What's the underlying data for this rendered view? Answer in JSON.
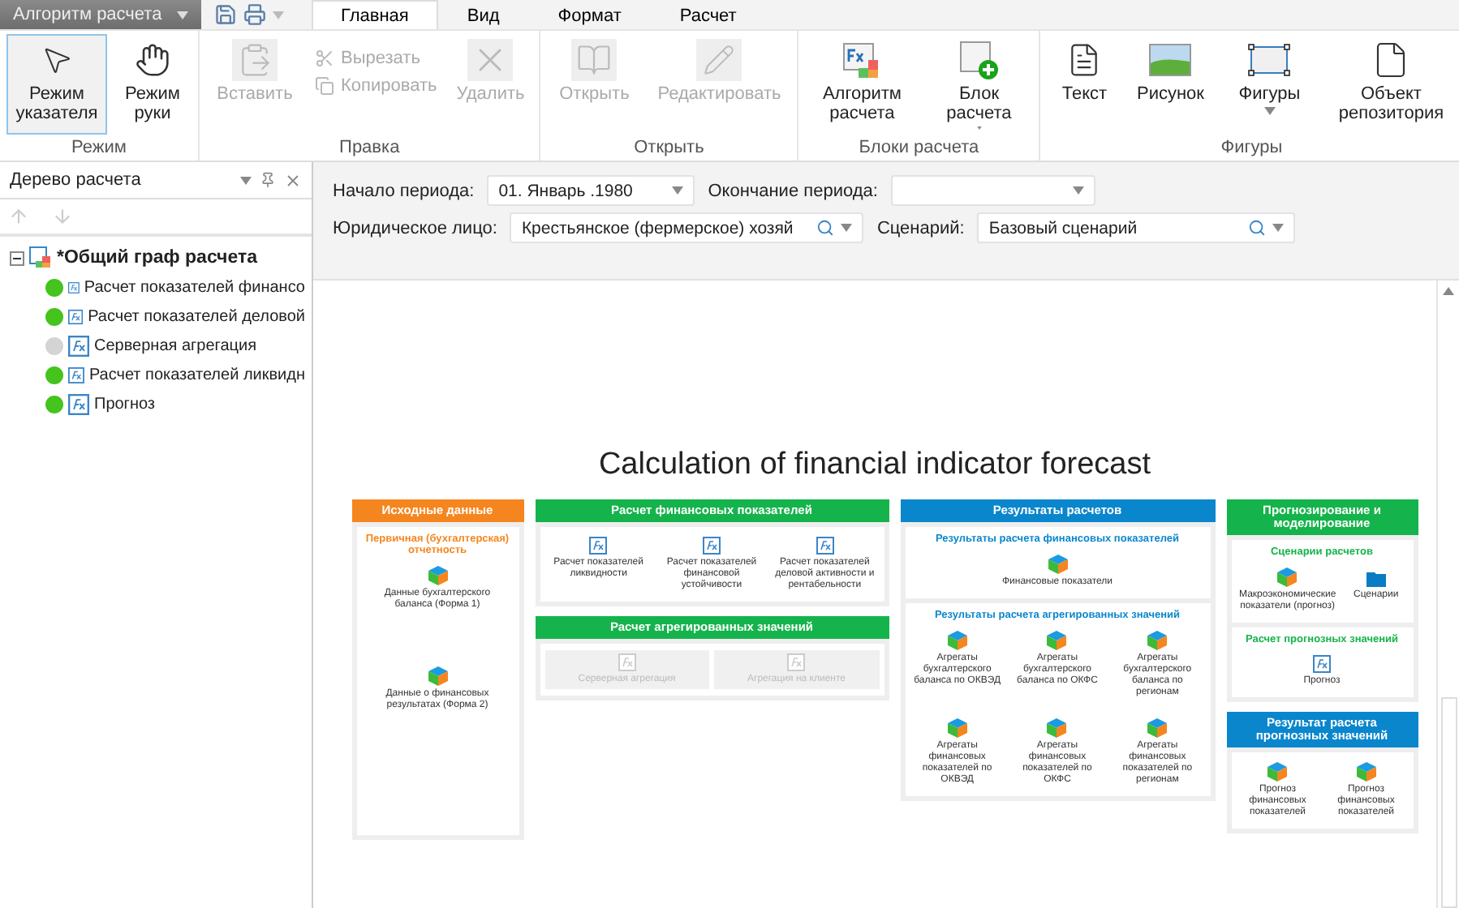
{
  "app_menu": {
    "label": "Алгоритм расчета"
  },
  "tabs": [
    {
      "label": "Главная",
      "selected": true
    },
    {
      "label": "Вид",
      "selected": false
    },
    {
      "label": "Формат",
      "selected": false
    },
    {
      "label": "Расчет",
      "selected": false
    }
  ],
  "ribbon": [
    {
      "label": "Режим",
      "buttons": [
        {
          "label": "Режим указателя",
          "kind": "large",
          "selected": true,
          "disabled": false
        },
        {
          "label": "Режим руки",
          "kind": "large",
          "selected": false,
          "disabled": false
        }
      ]
    },
    {
      "label": "Правка",
      "buttons": [
        {
          "label": "Вставить",
          "kind": "large",
          "selected": false,
          "disabled": true
        },
        {
          "label": "Вырезать",
          "kind": "small",
          "selected": false,
          "disabled": true
        },
        {
          "label": "Копировать",
          "kind": "small",
          "selected": false,
          "disabled": true
        },
        {
          "label": "Удалить",
          "kind": "large",
          "selected": false,
          "disabled": true
        }
      ]
    },
    {
      "label": "Открыть",
      "buttons": [
        {
          "label": "Открыть",
          "kind": "large",
          "selected": false,
          "disabled": true
        },
        {
          "label": "Редактировать",
          "kind": "large",
          "selected": false,
          "disabled": true
        }
      ]
    },
    {
      "label": "Блоки расчета",
      "buttons": [
        {
          "label": "Алгоритм расчета",
          "kind": "large",
          "selected": false,
          "disabled": false
        },
        {
          "label": "Блок расчета",
          "kind": "menu",
          "selected": false,
          "disabled": false
        }
      ]
    },
    {
      "label": "Фигуры",
      "buttons": [
        {
          "label": "Текст",
          "kind": "large",
          "selected": false,
          "disabled": false
        },
        {
          "label": "Рисунок",
          "kind": "large",
          "selected": false,
          "disabled": false
        },
        {
          "label": "Фигуры",
          "kind": "menu",
          "selected": false,
          "disabled": false
        },
        {
          "label": "Объект репозитория",
          "kind": "large",
          "selected": false,
          "disabled": false
        }
      ]
    }
  ],
  "tree": {
    "title": "Дерево расчета",
    "root": {
      "label": "*Общий граф расчета",
      "expanded": true,
      "children": [
        {
          "label": "Расчет показателей финансо",
          "color": "#44c41c"
        },
        {
          "label": "Расчет показателей деловой",
          "color": "#44c41c"
        },
        {
          "label": "Серверная агрегация",
          "color": "#d4d4d4"
        },
        {
          "label": "Расчет показателей ликвидн",
          "color": "#44c41c"
        },
        {
          "label": "Прогноз",
          "color": "#44c41c"
        }
      ]
    }
  },
  "params": {
    "start_period": {
      "label": "Начало периода:",
      "value": "01.  Январь  .1980"
    },
    "end_period": {
      "label": "Окончание периода:"
    },
    "legal_entity": {
      "label": "Юридическое лицо:",
      "value": "Крестьянское (фермерское) хозяй"
    },
    "scenario": {
      "label": "Сценарий:",
      "value": "Базовый сценарий"
    }
  },
  "diagram": {
    "title": "Calculation of financial indicator forecast",
    "columns": [
      {
        "sections": [
          {
            "header": "Исходные данные",
            "color": "#f5861f",
            "blocks": [
              {
                "kind": "stack",
                "subtitle": "Первичная (бухгалтерская) отчетность",
                "items": [
                  {
                    "label": "Данные бухгалтерского баланса (Форма 1)",
                    "kind": "cube",
                    "disabled": false
                  },
                  {
                    "label": "Данные о финансовых результатах (Форма 2)",
                    "kind": "cube",
                    "disabled": false
                  }
                ]
              }
            ]
          }
        ]
      },
      {
        "sections": [
          {
            "header": "Расчет финансовых показателей",
            "color": "#15b34b",
            "blocks": [
              {
                "kind": "row",
                "items": [
                  {
                    "label": "Расчет показателей ликвидности",
                    "kind": "calc",
                    "disabled": false
                  },
                  {
                    "label": "Расчет показателей финансовой устойчивости",
                    "kind": "calc",
                    "disabled": false
                  },
                  {
                    "label": "Расчет показателей деловой активности и рентабельности",
                    "kind": "calc",
                    "disabled": false
                  }
                ]
              }
            ]
          },
          {
            "header": "Расчет агрегированных значений",
            "color": "#15b34b",
            "blocks": [
              {
                "kind": "row",
                "items": [
                  {
                    "label": "Серверная агрегация",
                    "kind": "calc",
                    "disabled": true
                  },
                  {
                    "label": "Агрегация на клиенте",
                    "kind": "calc",
                    "disabled": true
                  }
                ]
              }
            ]
          }
        ]
      },
      {
        "sections": [
          {
            "header": "Результаты расчетов",
            "color": "#0a86cc",
            "blocks": [
              {
                "kind": "row",
                "subtitle": "Результаты расчета финансовых показателей",
                "items": [
                  {
                    "label": "Финансовые показатели",
                    "kind": "cube",
                    "disabled": false
                  }
                ]
              },
              {
                "kind": "row",
                "subtitle": "Результаты расчета агрегированных значений",
                "items": [
                  {
                    "label": "Агрегаты бухгалтерского баланса по ОКВЭД",
                    "kind": "cube",
                    "disabled": false
                  },
                  {
                    "label": "Агрегаты бухгалтерского баланса по ОКФС",
                    "kind": "cube",
                    "disabled": false
                  },
                  {
                    "label": "Агрегаты бухгалтерского баланса по регионам",
                    "kind": "cube",
                    "disabled": false
                  },
                  {
                    "label": "Агрегаты финансовых показателей по ОКВЭД",
                    "kind": "cube",
                    "disabled": false
                  },
                  {
                    "label": "Агрегаты финансовых показателей по ОКФС",
                    "kind": "cube",
                    "disabled": false
                  },
                  {
                    "label": "Агрегаты финансовых показателей по регионам",
                    "kind": "cube",
                    "disabled": false
                  }
                ]
              }
            ]
          }
        ]
      },
      {
        "sections": [
          {
            "header": "Прогнозирование и моделирование",
            "color": "#15b34b",
            "blocks": [
              {
                "kind": "row",
                "subtitle": "Сценарии расчетов",
                "items": [
                  {
                    "label": "Макроэкономические показатели (прогноз)",
                    "kind": "cube",
                    "disabled": false
                  },
                  {
                    "label": "Сценарии",
                    "kind": "folder",
                    "disabled": false
                  }
                ]
              },
              {
                "kind": "row",
                "subtitle": "Расчет прогнозных значений",
                "items": [
                  {
                    "label": "Прогноз",
                    "kind": "calc",
                    "disabled": false
                  }
                ]
              }
            ]
          },
          {
            "header": "Результат расчета прогнозных значений",
            "color": "#0a86cc",
            "blocks": [
              {
                "kind": "row",
                "items": [
                  {
                    "label": "Прогноз финансовых показателей",
                    "kind": "cube",
                    "disabled": false
                  },
                  {
                    "label": "Прогноз финансовых показателей",
                    "kind": "cube",
                    "disabled": false
                  }
                ]
              }
            ]
          }
        ]
      }
    ]
  }
}
